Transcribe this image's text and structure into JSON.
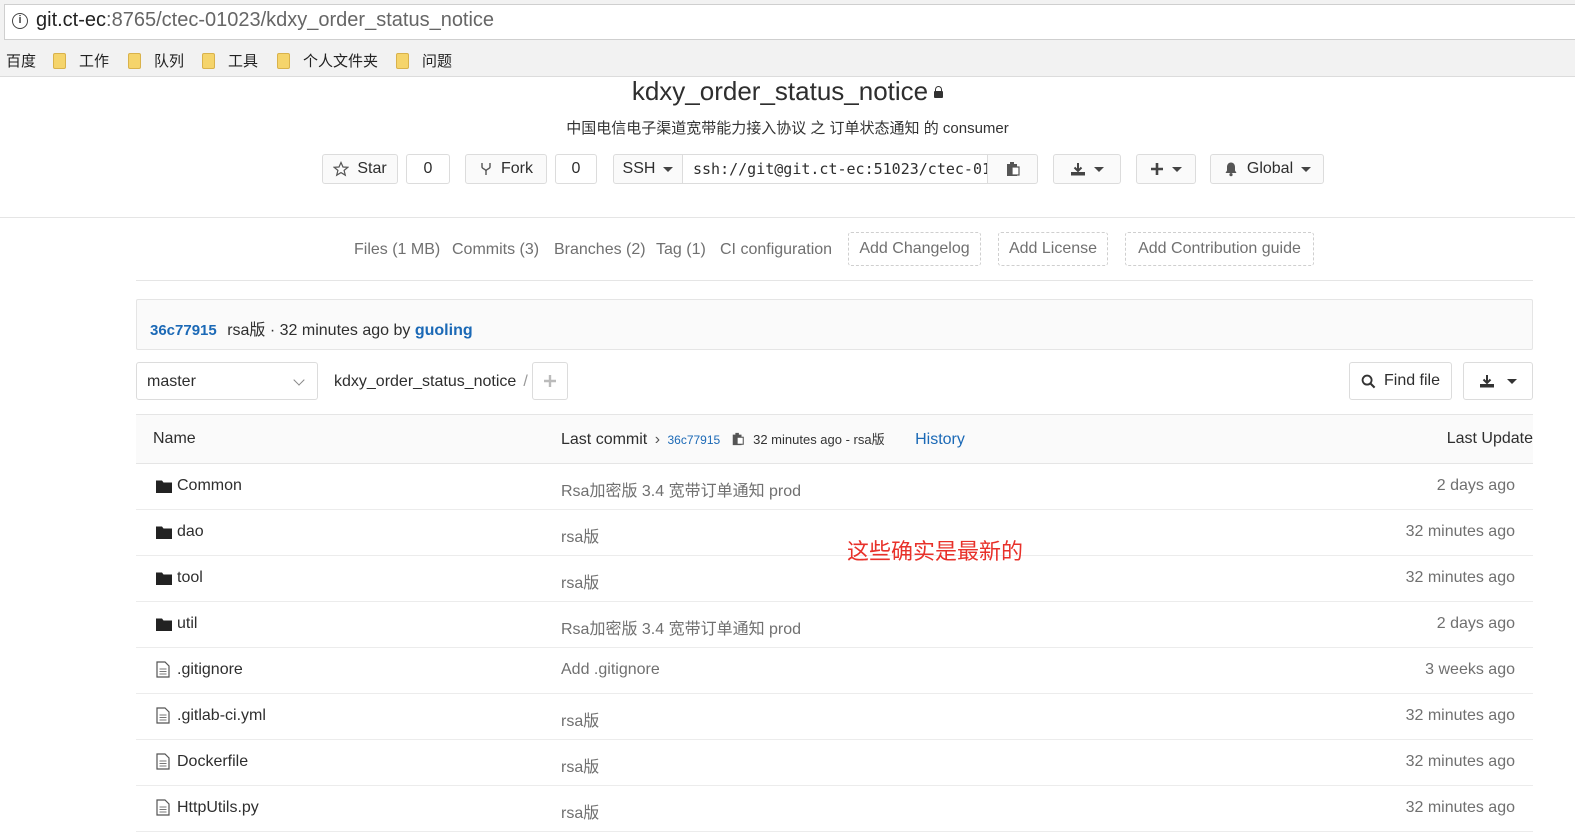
{
  "browser": {
    "url_host": "git.ct-ec",
    "url_path": ":8765/ctec-01023/kdxy_order_status_notice",
    "bookmarks": [
      "百度",
      "工作",
      "队列",
      "工具",
      "个人文件夹",
      "问题"
    ]
  },
  "project": {
    "title": "kdxy_order_status_notice",
    "description": "中国电信电子渠道宽带能力接入协议 之 订单状态通知 的 consumer",
    "star_label": "Star",
    "star_count": "0",
    "fork_label": "Fork",
    "fork_count": "0",
    "protocol": "SSH",
    "clone_url": "ssh://git@git.ct-ec:51023/ctec-01",
    "notify_label": "Global"
  },
  "nav": {
    "files": "Files (1 MB)",
    "commits": "Commits (3)",
    "branches": "Branches (2)",
    "tag": "Tag (1)",
    "ci": "CI configuration",
    "add_changelog": "Add Changelog",
    "add_license": "Add License",
    "add_contribution": "Add Contribution guide"
  },
  "last_commit": {
    "sha": "36c77915",
    "message": "rsa版 · 32 minutes ago by",
    "author": "guoling"
  },
  "toolbar": {
    "branch": "master",
    "breadcrumb": "kdxy_order_status_notice",
    "separator": "/",
    "find_file": "Find file"
  },
  "table": {
    "col_name": "Name",
    "col_last_commit": "Last commit",
    "commit_sha": "36c77915",
    "commit_meta": "32 minutes ago - rsa版",
    "history": "History",
    "col_last_update": "Last Update",
    "rows": [
      {
        "type": "folder",
        "name": "Common",
        "message": "Rsa加密版 3.4 宽带订单通知 prod",
        "updated": "2 days ago"
      },
      {
        "type": "folder",
        "name": "dao",
        "message": "rsa版",
        "updated": "32 minutes ago"
      },
      {
        "type": "folder",
        "name": "tool",
        "message": "rsa版",
        "updated": "32 minutes ago"
      },
      {
        "type": "folder",
        "name": "util",
        "message": "Rsa加密版 3.4 宽带订单通知 prod",
        "updated": "2 days ago"
      },
      {
        "type": "file",
        "name": ".gitignore",
        "message": "Add .gitignore",
        "updated": "3 weeks ago"
      },
      {
        "type": "file",
        "name": ".gitlab-ci.yml",
        "message": "rsa版",
        "updated": "32 minutes ago"
      },
      {
        "type": "file",
        "name": "Dockerfile",
        "message": "rsa版",
        "updated": "32 minutes ago"
      },
      {
        "type": "file",
        "name": "HttpUtils.py",
        "message": "rsa版",
        "updated": "32 minutes ago"
      }
    ]
  },
  "annotation": "这些确实是最新的",
  "colors": {
    "link": "#1b69b6",
    "annotation": "#e8312a",
    "muted": "#707070"
  }
}
